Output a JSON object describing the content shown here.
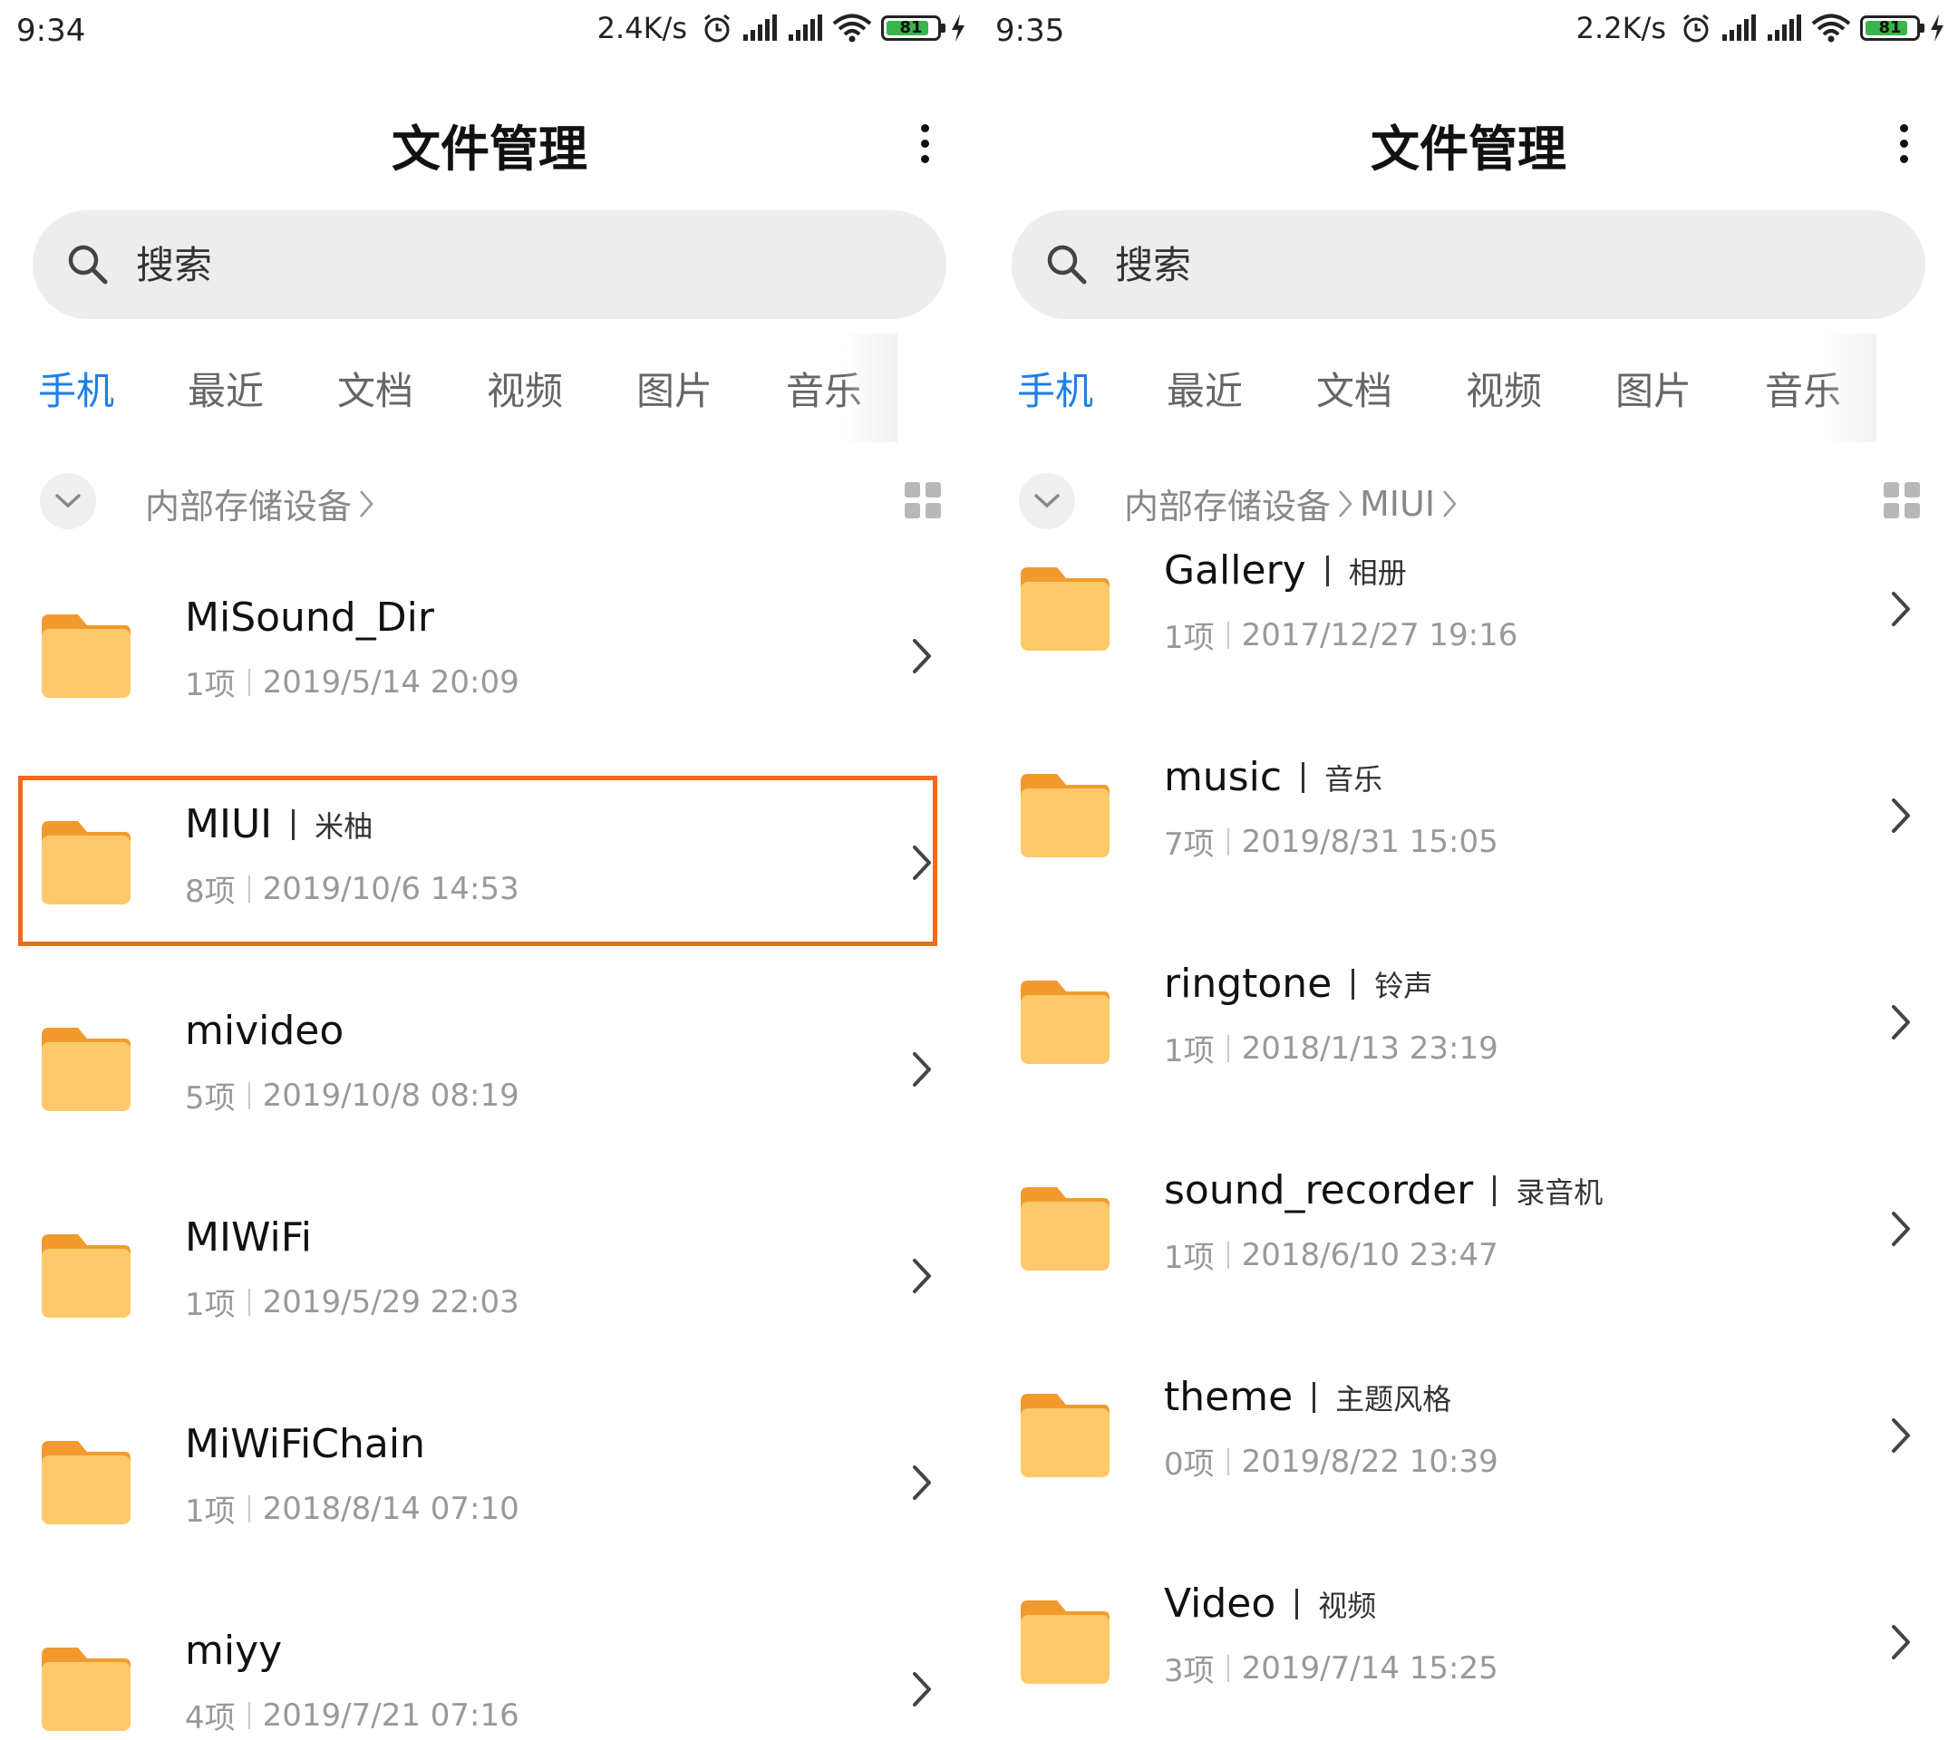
{
  "screens": [
    {
      "status": {
        "time": "9:34",
        "speed": "2.4K/s",
        "battery": "81"
      },
      "title": "文件管理",
      "search_placeholder": "搜索",
      "tabs": [
        "手机",
        "最近",
        "文档",
        "视频",
        "图片",
        "音乐"
      ],
      "active_tab": "手机",
      "breadcrumb": [
        "内部存储设备"
      ],
      "folders": [
        {
          "name": "MiSound_Dir",
          "alias": "",
          "count": "1项",
          "date": "2019/5/14 20:09"
        },
        {
          "name": "MIUI",
          "alias": "米柚",
          "count": "8项",
          "date": "2019/10/6 14:53",
          "highlighted": true
        },
        {
          "name": "mivideo",
          "alias": "",
          "count": "5项",
          "date": "2019/10/8 08:19"
        },
        {
          "name": "MIWiFi",
          "alias": "",
          "count": "1项",
          "date": "2019/5/29 22:03"
        },
        {
          "name": "MiWiFiChain",
          "alias": "",
          "count": "1项",
          "date": "2018/8/14 07:10"
        },
        {
          "name": "miyy",
          "alias": "",
          "count": "4项",
          "date": "2019/7/21 07:16"
        }
      ]
    },
    {
      "status": {
        "time": "9:35",
        "speed": "2.2K/s",
        "battery": "81"
      },
      "title": "文件管理",
      "search_placeholder": "搜索",
      "tabs": [
        "手机",
        "最近",
        "文档",
        "视频",
        "图片",
        "音乐"
      ],
      "active_tab": "手机",
      "breadcrumb": [
        "内部存储设备",
        "MIUI"
      ],
      "folders": [
        {
          "name": "Gallery",
          "alias": "相册",
          "count": "1项",
          "date": "2017/12/27 19:16"
        },
        {
          "name": "music",
          "alias": "音乐",
          "count": "7项",
          "date": "2019/8/31 15:05"
        },
        {
          "name": "ringtone",
          "alias": "铃声",
          "count": "1项",
          "date": "2018/1/13 23:19"
        },
        {
          "name": "sound_recorder",
          "alias": "录音机",
          "count": "1项",
          "date": "2018/6/10 23:47"
        },
        {
          "name": "theme",
          "alias": "主题风格",
          "count": "0项",
          "date": "2019/8/22 10:39"
        },
        {
          "name": "Video",
          "alias": "视频",
          "count": "3项",
          "date": "2019/7/14 15:25"
        }
      ]
    }
  ],
  "colors": {
    "accent": "#1f7fe6",
    "folder_body": "#fdc96a",
    "folder_tab": "#f29a2e",
    "highlight_border": "#ee6a1c",
    "search_bg": "#ededed",
    "battery_fill": "#39b54a"
  },
  "icons": {
    "search": "search-icon",
    "more": "more-vertical-icon",
    "collapse": "chevron-down-icon",
    "grid": "grid-view-icon",
    "folder": "folder-icon",
    "row_arrow": "chevron-right-icon",
    "alarm": "alarm-icon",
    "signal": "signal-icon",
    "wifi": "wifi-icon",
    "battery": "battery-icon",
    "charging": "charging-icon"
  }
}
